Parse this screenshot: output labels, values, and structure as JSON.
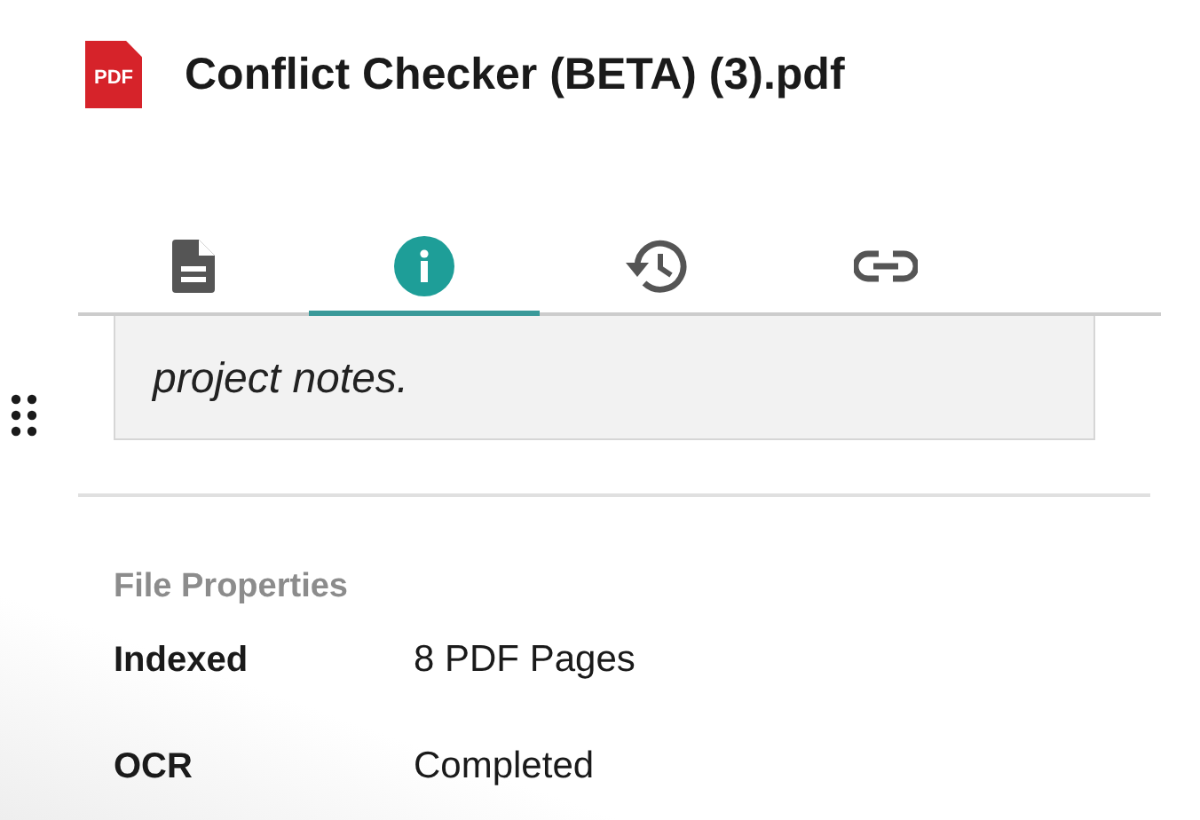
{
  "file": {
    "title": "Conflict Checker (BETA) (3).pdf",
    "badge": "PDF"
  },
  "tabs": [
    {
      "kind": "document",
      "selected": false
    },
    {
      "kind": "info",
      "selected": true
    },
    {
      "kind": "history",
      "selected": false
    },
    {
      "kind": "link",
      "selected": false
    }
  ],
  "note": {
    "text": "project notes."
  },
  "properties": {
    "heading": "File Properties",
    "rows": [
      {
        "label": "Indexed",
        "value": "8 PDF Pages"
      },
      {
        "label": "OCR",
        "value": "Completed"
      }
    ]
  }
}
